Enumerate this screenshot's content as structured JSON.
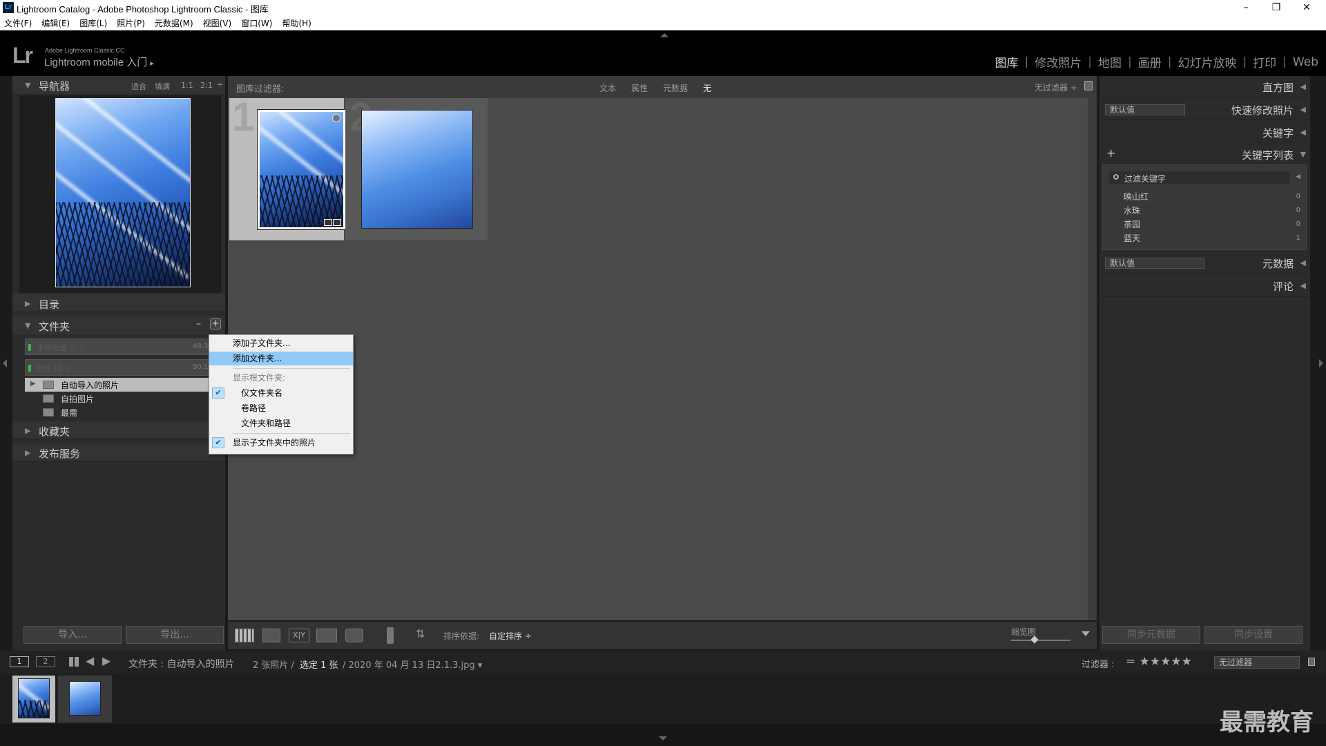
{
  "window": {
    "title": "Lightroom Catalog - Adobe Photoshop Lightroom Classic - 图库",
    "app_icon": "Lr",
    "minimize": "–",
    "maximize": "❐",
    "close": "✕"
  },
  "menu": [
    "文件(F)",
    "编辑(E)",
    "图库(L)",
    "照片(P)",
    "元数据(M)",
    "视图(V)",
    "窗口(W)",
    "帮助(H)"
  ],
  "brand": {
    "logo": "Lr",
    "line1": "Adobe Lightroom Classic CC",
    "line2": "Lightroom mobile 入门",
    "arrow": "▸"
  },
  "modules": [
    {
      "label": "图库",
      "active": true
    },
    {
      "label": "修改照片",
      "active": false
    },
    {
      "label": "地图",
      "active": false
    },
    {
      "label": "画册",
      "active": false
    },
    {
      "label": "幻灯片放映",
      "active": false
    },
    {
      "label": "打印",
      "active": false
    },
    {
      "label": "Web",
      "active": false
    }
  ],
  "module_sep": "|",
  "navigator": {
    "title": "导航器",
    "zoom_fit": "适合",
    "zoom_fill": "填满",
    "zoom_1": "1:1",
    "zoom_2": "2:1"
  },
  "left_panels": {
    "catalog": "目录",
    "folders": "文件夹",
    "minus": "–",
    "plus": "+",
    "collections": "收藏夹",
    "publish": "发布服务"
  },
  "volumes": [
    {
      "name": "本地磁盘 (C:)",
      "size": "48.3 /"
    },
    {
      "name": "软件 (D:)",
      "size": "90.1 /"
    }
  ],
  "folders": [
    {
      "name": "自动导入的照片",
      "selected": true
    },
    {
      "name": "自拍图片",
      "selected": false
    },
    {
      "name": "最需",
      "selected": false
    }
  ],
  "folder_count": "2",
  "context_menu": {
    "add_subfolder": "添加子文件夹...",
    "add_folder": "添加文件夹...",
    "show_root": "显示根文件夹:",
    "only_name": "仅文件夹名",
    "volume_path": "卷路径",
    "folder_and_path": "文件夹和路径",
    "show_sub_photos": "显示子文件夹中的照片",
    "check": "✔"
  },
  "filter_bar": {
    "label": "图库过滤器:",
    "text": "文本",
    "attribute": "属性",
    "metadata": "元数据",
    "none": "无",
    "no_filter": "无过滤器 ÷"
  },
  "grid": {
    "cell1_index": "1",
    "cell2_index": "2"
  },
  "toolbar": {
    "import": "导入...",
    "export": "导出...",
    "sort_by": "排序依据:",
    "sort_value": "自定排序 ÷",
    "thumbnails": "缩览图",
    "compare": "X|Y"
  },
  "right_panels": {
    "histogram": "直方图",
    "preset_default": "默认值",
    "quick_develop": "快速修改照片",
    "keywording": "关键字",
    "keyword_list": "关键字列表",
    "add": "+",
    "filter_keywords": "过滤关键字",
    "metadata_default": "默认值",
    "metadata": "元数据",
    "comments": "评论",
    "sync_metadata": "同步元数据",
    "sync_settings": "同步设置"
  },
  "keywords": [
    {
      "name": "映山红",
      "count": "0"
    },
    {
      "name": "水珠",
      "count": "0"
    },
    {
      "name": "茶园",
      "count": "0"
    },
    {
      "name": "蓝天",
      "count": "1"
    }
  ],
  "filmstrip_bar": {
    "page1": "1",
    "page2": "2",
    "path": "文件夹 : 自动导入的照片",
    "count": "2 张照片 /",
    "selected": "选定 1 张",
    "file": "/ 2020 年 04 月 13 日2.1.3.jpg ▾",
    "filter_label": "过滤器 :",
    "stars": "= ★★★★★",
    "no_filter": "无过滤器"
  },
  "watermark": "最需教育"
}
